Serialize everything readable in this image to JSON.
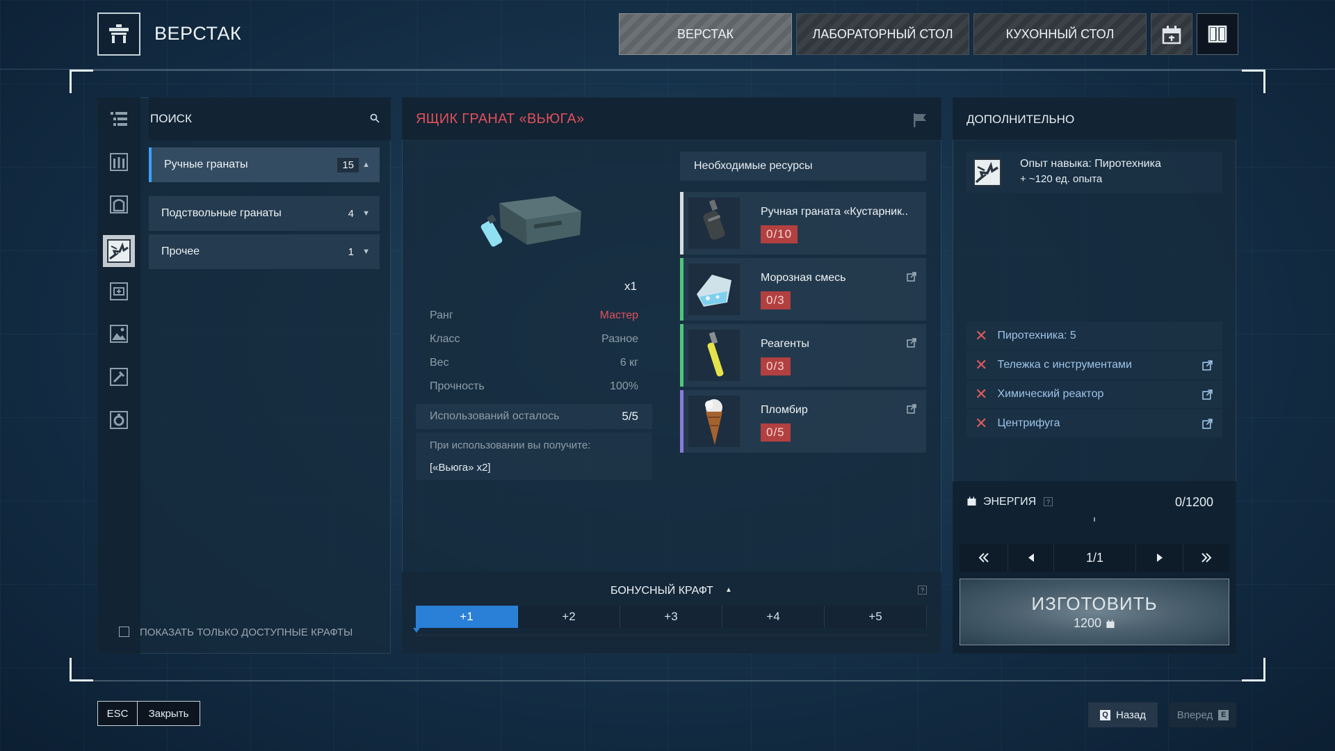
{
  "header": {
    "title": "ВЕРСТАК",
    "tabs": [
      {
        "label": "ВЕРСТАК",
        "active": true
      },
      {
        "label": "ЛАБОРАТОРНЫЙ СТОЛ",
        "active": false
      },
      {
        "label": "КУХОННЫЙ СТОЛ",
        "active": false
      }
    ]
  },
  "left": {
    "search_label": "ПОИСК",
    "categories": [
      {
        "label": "Ручные гранаты",
        "count": "15"
      },
      {
        "label": "Подствольные гранаты",
        "count": "4"
      },
      {
        "label": "Прочее",
        "count": "1"
      }
    ],
    "filter_label": "ПОКАЗАТЬ ТОЛЬКО ДОСТУПНЫЕ КРАФТЫ"
  },
  "item": {
    "title": "ЯЩИК ГРАНАТ «ВЬЮГА»",
    "quantity": "x1",
    "stats": [
      {
        "label": "Ранг",
        "value": "Мастер"
      },
      {
        "label": "Класс",
        "value": "Разное"
      },
      {
        "label": "Вес",
        "value": "6 кг"
      },
      {
        "label": "Прочность",
        "value": "100%"
      }
    ],
    "uses_label": "Использований осталось",
    "uses_value": "5/5",
    "yield_label": "При использовании вы получите:",
    "yield_value": "[«Вьюга» x2]"
  },
  "resources": {
    "header": "Необходимые ресурсы",
    "items": [
      {
        "name": "Ручная граната «Кустарник..",
        "count": "0/10",
        "color": "#d8dde0"
      },
      {
        "name": "Морозная смесь",
        "count": "0/3",
        "color": "#4fc77a"
      },
      {
        "name": "Реагенты",
        "count": "0/3",
        "color": "#4fc77a"
      },
      {
        "name": "Пломбир",
        "count": "0/5",
        "color": "#8a7ad8"
      }
    ]
  },
  "bonus": {
    "label": "БОНУСНЫЙ КРАФТ",
    "levels": [
      "+1",
      "+2",
      "+3",
      "+4",
      "+5"
    ],
    "help": "?"
  },
  "extra": {
    "title": "ДОПОЛНИТЕЛЬНО",
    "skill_line1": "Опыт навыка: Пиротехника",
    "skill_line2": "+ ~120 ед. опыта",
    "requirements": [
      {
        "label": "Пиротехника: 5",
        "link": false
      },
      {
        "label": "Тележка с инструментами",
        "link": true
      },
      {
        "label": "Химический реактор",
        "link": true
      },
      {
        "label": "Центрифуга",
        "link": true
      }
    ],
    "energy_label": "ЭНЕРГИЯ",
    "energy_value": "0/1200",
    "energy_help": "?",
    "page": "1/1",
    "craft_label": "ИЗГОТОВИТЬ",
    "craft_cost": "1200"
  },
  "footer": {
    "esc_key": "ESC",
    "close_label": "Закрыть",
    "back_key": "Q",
    "back_label": "Назад",
    "forward_label": "Вперед",
    "forward_key": "E"
  }
}
